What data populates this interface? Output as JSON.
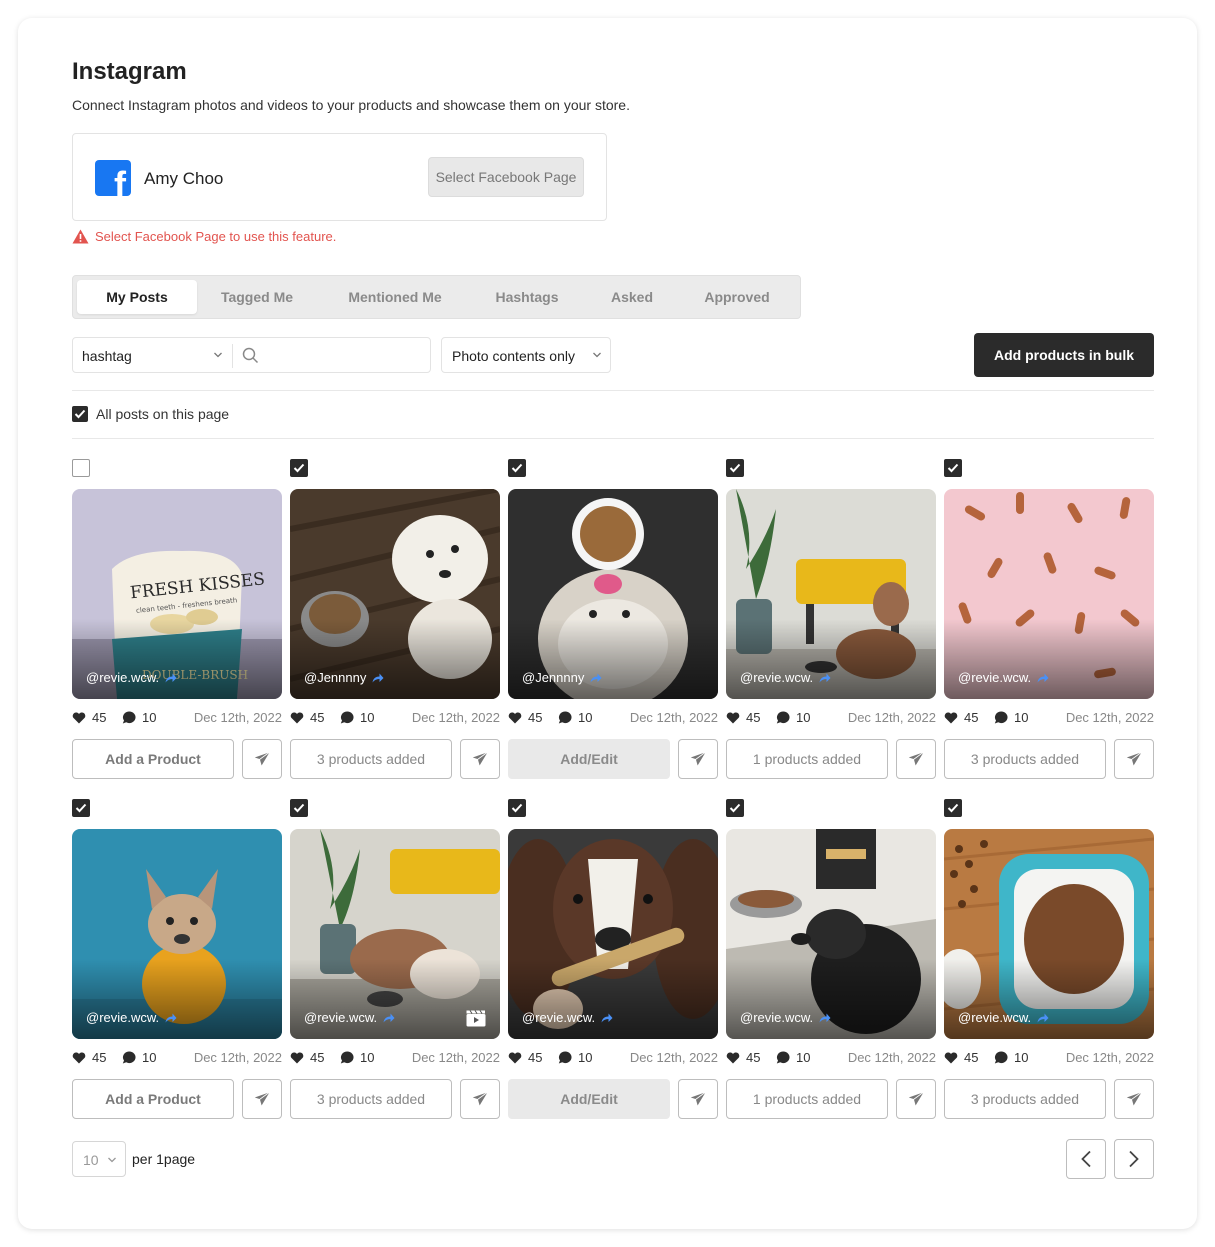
{
  "header": {
    "title": "Instagram",
    "subtitle": "Connect Instagram photos and videos to your products and showcase them on your store."
  },
  "facebook": {
    "logo_icon": "facebook-icon",
    "account_name": "Amy Choo",
    "select_page_label": "Select Facebook Page",
    "warning": "Select Facebook Page to use this feature."
  },
  "tabs": [
    {
      "label": "My Posts",
      "active": true
    },
    {
      "label": "Tagged Me",
      "active": false
    },
    {
      "label": "Mentioned Me",
      "active": false
    },
    {
      "label": "Hashtags",
      "active": false
    },
    {
      "label": "Asked",
      "active": false
    },
    {
      "label": "Approved",
      "active": false
    }
  ],
  "filters": {
    "search_type": "hashtag",
    "search_value": "",
    "content_filter": "Photo contents only",
    "bulk_button": "Add products in bulk"
  },
  "select_all": {
    "label": "All posts on this page",
    "checked": true
  },
  "posts": [
    {
      "handle": "@revie.wcw.",
      "likes": "45",
      "comments": "10",
      "date": "Dec 12th, 2022",
      "action": "Add a Product",
      "action_style": "bold",
      "checked": false,
      "video": false
    },
    {
      "handle": "@Jennnny",
      "likes": "45",
      "comments": "10",
      "date": "Dec 12th, 2022",
      "action": "3 products added",
      "action_style": "normal",
      "checked": true,
      "video": false
    },
    {
      "handle": "@Jennnny",
      "likes": "45",
      "comments": "10",
      "date": "Dec 12th, 2022",
      "action": "Add/Edit",
      "action_style": "disabled",
      "checked": true,
      "video": false
    },
    {
      "handle": "@revie.wcw.",
      "likes": "45",
      "comments": "10",
      "date": "Dec 12th, 2022",
      "action": "1 products added",
      "action_style": "normal",
      "checked": true,
      "video": false
    },
    {
      "handle": "@revie.wcw.",
      "likes": "45",
      "comments": "10",
      "date": "Dec 12th, 2022",
      "action": "3 products added",
      "action_style": "normal",
      "checked": true,
      "video": false
    },
    {
      "handle": "@revie.wcw.",
      "likes": "45",
      "comments": "10",
      "date": "Dec 12th, 2022",
      "action": "Add a Product",
      "action_style": "bold",
      "checked": true,
      "video": false
    },
    {
      "handle": "@revie.wcw.",
      "likes": "45",
      "comments": "10",
      "date": "Dec 12th, 2022",
      "action": "3 products added",
      "action_style": "normal",
      "checked": true,
      "video": true
    },
    {
      "handle": "@revie.wcw.",
      "likes": "45",
      "comments": "10",
      "date": "Dec 12th, 2022",
      "action": "Add/Edit",
      "action_style": "disabled",
      "checked": true,
      "video": false
    },
    {
      "handle": "@revie.wcw.",
      "likes": "45",
      "comments": "10",
      "date": "Dec 12th, 2022",
      "action": "1 products added",
      "action_style": "normal",
      "checked": true,
      "video": false
    },
    {
      "handle": "@revie.wcw.",
      "likes": "45",
      "comments": "10",
      "date": "Dec 12th, 2022",
      "action": "3 products added",
      "action_style": "normal",
      "checked": true,
      "video": false
    }
  ],
  "pagination": {
    "per_page_value": "10",
    "per_page_label": "per 1page"
  },
  "colors": {
    "primary_dark": "#2b2b2b",
    "warning": "#e2544f",
    "facebook_blue": "#1877f2",
    "share_arrow": "#4a90f5"
  }
}
